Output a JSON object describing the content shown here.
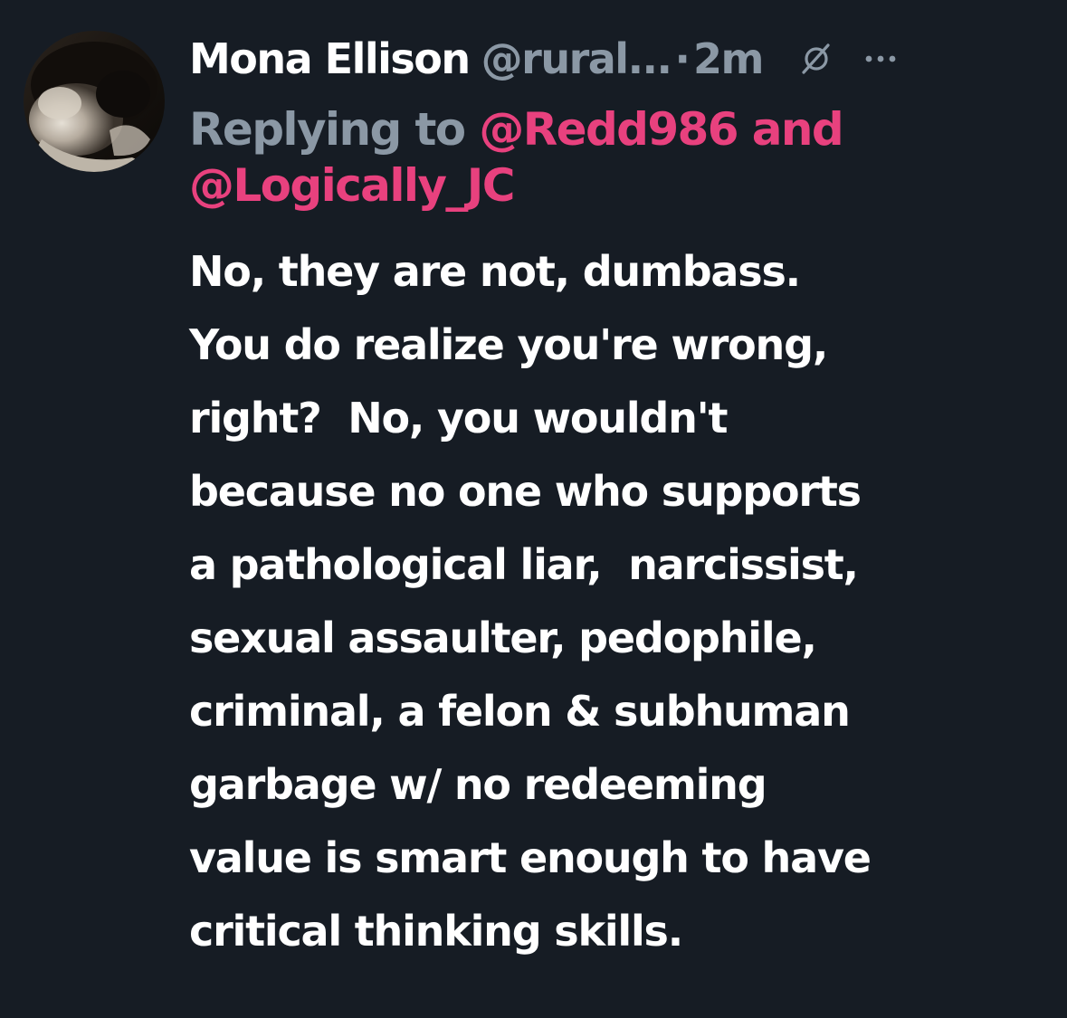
{
  "tweet": {
    "display_name": "Mona Ellison",
    "handle": "@rural...",
    "separator": "·",
    "time": "2m",
    "replying_label": "Replying to",
    "reply_mentions": [
      "@Redd986",
      "@Logically_JC"
    ],
    "mention_joiner": "and",
    "body_lines": [
      "No, they are not, dumbass.",
      "You do realize you're wrong,",
      "right?  No, you wouldn't",
      "because no one who supports",
      "a pathological liar,  narcissist,",
      "sexual assaulter, pedophile,",
      "criminal, a felon & subhuman",
      "garbage w/ no redeeming",
      "value is smart enough to have",
      "critical thinking skills."
    ]
  },
  "icons": {
    "grok": "grok-slash-icon",
    "more": "more-dots-icon",
    "avatar": "cat-photo-avatar"
  },
  "colors": {
    "background": "#161c24",
    "text_primary": "#ffffff",
    "text_secondary": "#8b98a5",
    "mention_accent": "#e8417e"
  }
}
